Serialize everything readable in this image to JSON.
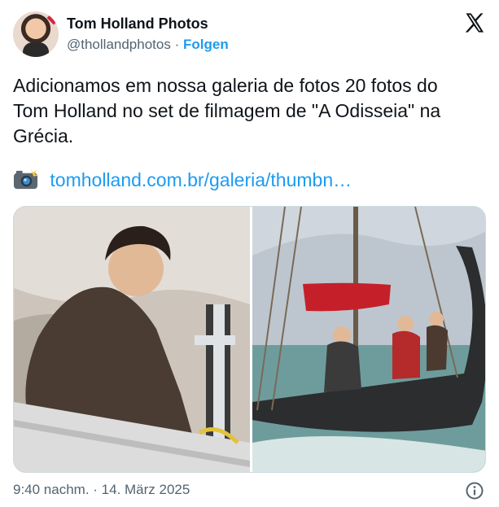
{
  "author": {
    "display_name": "Tom Holland Photos",
    "handle": "@thollandphotos",
    "separator": "·",
    "follow_label": "Folgen",
    "avatar_icon": "profile-avatar"
  },
  "platform_icon": "x-logo-icon",
  "tweet": {
    "text": "Adicionamos em nossa galeria de fotos 20 fotos do\nTom Holland no set de filmagem de \"A Odisseia\" na\nGrécia.",
    "link_icon": "camera-flash-icon",
    "link_text": "tomholland.com.br/galeria/thumbn…"
  },
  "media": {
    "count": 2,
    "photos": [
      "photo-1",
      "photo-2"
    ]
  },
  "footer": {
    "timestamp": "9:40 nachm. · 14. März 2025",
    "info_icon": "info-icon"
  },
  "colors": {
    "accent": "#1d9bf0",
    "text_primary": "#0f1419",
    "text_secondary": "#536471",
    "border": "#cfd9de"
  }
}
